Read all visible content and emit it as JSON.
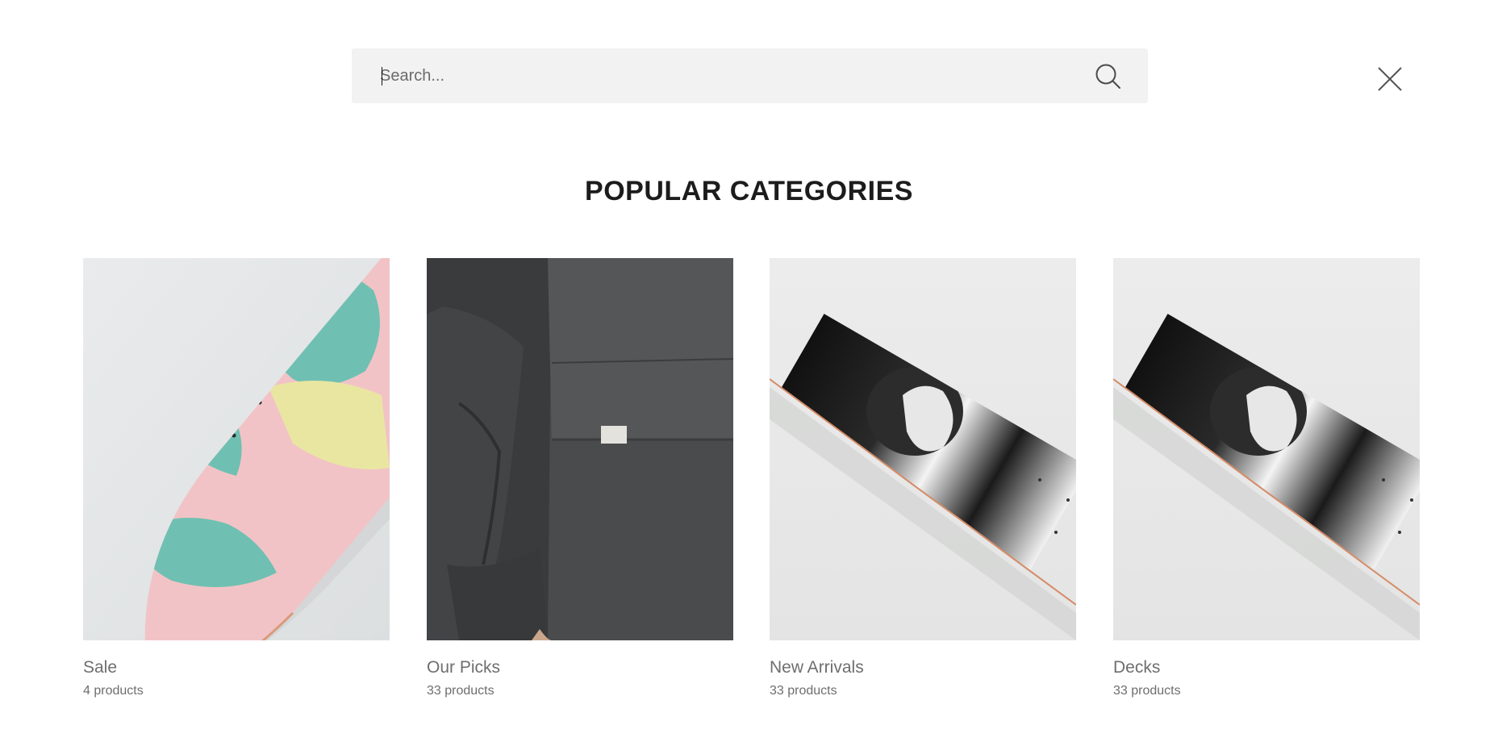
{
  "search": {
    "placeholder": "Search...",
    "value": ""
  },
  "icons": {
    "search": "search-icon",
    "close": "close-icon"
  },
  "heading": "POPULAR CATEGORIES",
  "categories": [
    {
      "title": "Sale",
      "count": "4 products",
      "image": "pink-teal-skateboard-deck"
    },
    {
      "title": "Our Picks",
      "count": "33 products",
      "image": "dark-grey-jacket"
    },
    {
      "title": "New Arrivals",
      "count": "33 products",
      "image": "black-white-skateboard-deck"
    },
    {
      "title": "Decks",
      "count": "33 products",
      "image": "black-white-skateboard-deck"
    }
  ],
  "colors": {
    "search_bg": "#f2f2f2",
    "heading": "#1c1c1c",
    "muted_text": "#6e6e6e"
  }
}
